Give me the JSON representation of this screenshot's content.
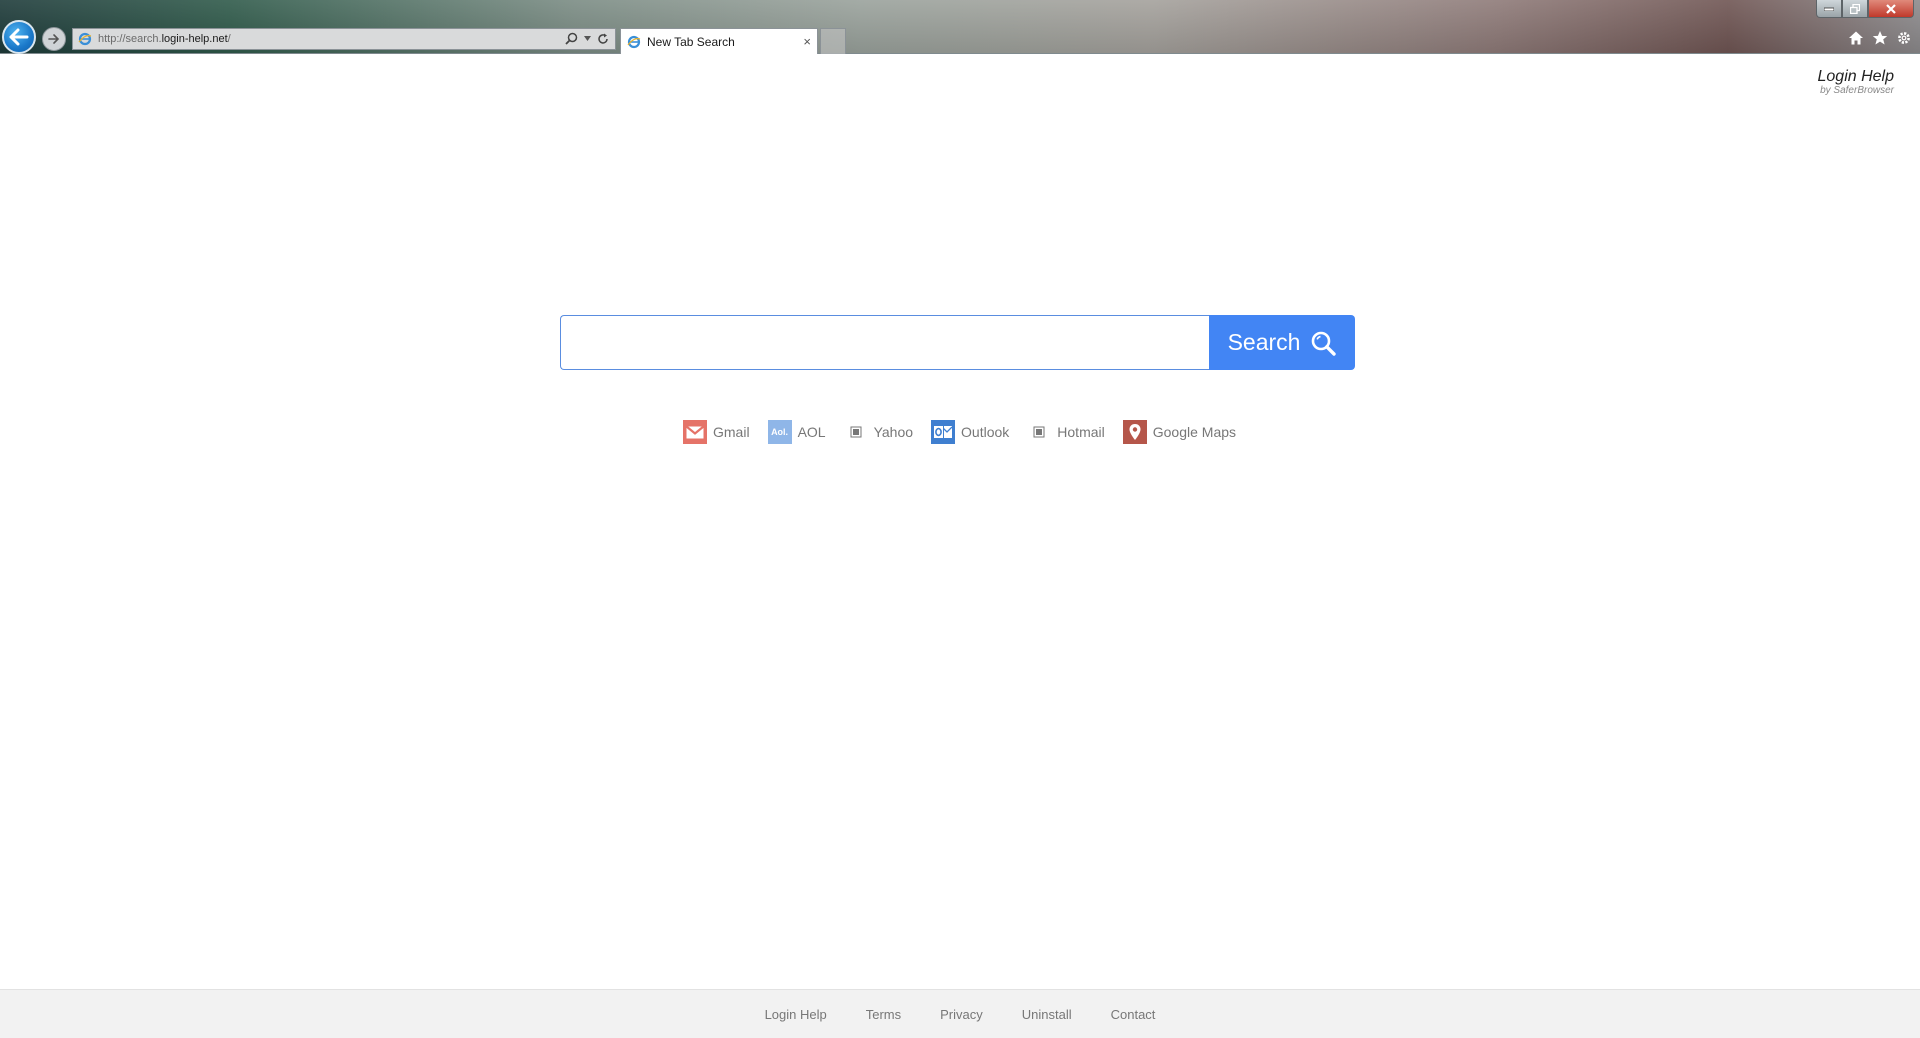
{
  "browser": {
    "address": {
      "prefix": "http://search.",
      "domain": "login-help.net",
      "suffix": "/"
    },
    "tab_title": "New Tab Search",
    "tab_close": "×"
  },
  "brand": {
    "name": "Login Help",
    "subtitle": "by SaferBrowser"
  },
  "search": {
    "input_value": "",
    "button_label": "Search"
  },
  "quicklinks": [
    {
      "label": "Gmail",
      "icon": "gmail-icon"
    },
    {
      "label": "AOL",
      "icon": "aol-icon",
      "icon_text": "Aol."
    },
    {
      "label": "Yahoo",
      "icon": "yahoo-icon"
    },
    {
      "label": "Outlook",
      "icon": "outlook-icon"
    },
    {
      "label": "Hotmail",
      "icon": "hotmail-icon"
    },
    {
      "label": "Google Maps",
      "icon": "google-maps-icon"
    }
  ],
  "footer": {
    "links": [
      "Login Help",
      "Terms",
      "Privacy",
      "Uninstall",
      "Contact"
    ]
  },
  "colors": {
    "accent": "#4285f4",
    "gmail": "#e57368",
    "aol": "#8fb6e8",
    "outlook": "#3f7fd0",
    "maps": "#b5564a"
  }
}
